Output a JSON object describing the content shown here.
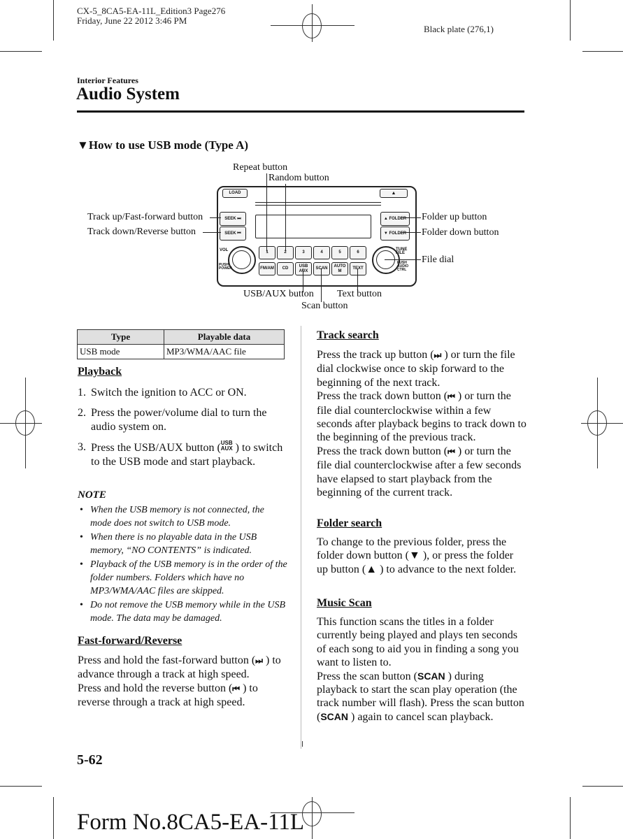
{
  "print_header": {
    "file_info": "CX-5_8CA5-EA-11L_Edition3 Page276",
    "date_info": "Friday, June 22 2012 3:46 PM",
    "plate": "Black plate (276,1)"
  },
  "section": {
    "label": "Interior Features",
    "title": "Audio System"
  },
  "subsection": {
    "marker": "▼",
    "title": "How to use USB mode (Type A)"
  },
  "diagram": {
    "callouts": {
      "repeat": "Repeat button",
      "random": "Random button",
      "track_up": "Track up/Fast-forward button",
      "track_down": "Track down/Reverse button",
      "folder_up": "Folder up button",
      "folder_down": "Folder down button",
      "file_dial": "File dial",
      "usb_aux": "USB/AUX button",
      "text": "Text button",
      "scan": "Scan button"
    },
    "device_labels": {
      "load": "LOAD",
      "eject": "▲",
      "seek_up": "SEEK ⏭",
      "seek_down": "SEEK ⏮",
      "folder_up": "▲ FOLDER",
      "folder_down": "▼ FOLDER",
      "presets": [
        "1",
        "2",
        "3",
        "4",
        "5",
        "6"
      ],
      "func_buttons": [
        "FM/AM",
        "CD",
        "USB AUX",
        "SCAN",
        "AUTO M",
        "TEXT"
      ],
      "vol": "VOL",
      "push_power": "PUSH POWER",
      "tune_file": "TUNE FILE",
      "push_audio_ctrl": "PUSH AUDIO CTRL"
    }
  },
  "table": {
    "headers": [
      "Type",
      "Playable data"
    ],
    "rows": [
      [
        "USB mode",
        "MP3/WMA/AAC file"
      ]
    ]
  },
  "left_column": {
    "playback": {
      "heading": "Playback",
      "steps": [
        {
          "num": "1.",
          "text": "Switch the ignition to ACC or ON."
        },
        {
          "num": "2.",
          "text": "Press the power/volume dial to turn the audio system on."
        },
        {
          "num": "3.",
          "text_before": "Press the USB/AUX button (",
          "icon_top": "USB",
          "icon_bottom": "AUX",
          "text_after": " ) to switch to the USB mode and start playback."
        }
      ]
    },
    "note": {
      "heading": "NOTE",
      "bullet": "•",
      "items": [
        "When the USB memory is not connected, the mode does not switch to USB mode.",
        "When there is no playable data in the USB memory, “NO CONTENTS” is indicated.",
        "Playback of the USB memory is in the order of the folder numbers. Folders which have no MP3/WMA/AAC files are skipped.",
        "Do not remove the USB memory while in the USB mode. The data may be damaged."
      ]
    },
    "fast_forward": {
      "heading": "Fast-forward/Reverse",
      "p1_before": "Press and hold the fast-forward button (",
      "p1_glyph": "⏭",
      "p1_after": " ) to advance through a track at high speed.",
      "p2_before": "Press and hold the reverse button (",
      "p2_glyph": "⏮",
      "p2_after": " ) to reverse through a track at high speed."
    }
  },
  "right_column": {
    "track_search": {
      "heading": "Track search",
      "p1_before": "Press the track up button (",
      "p1_glyph": "⏭",
      "p1_after": " ) or turn the file dial clockwise once to skip forward to the beginning of the next track.",
      "p2_before": "Press the track down button (",
      "p2_glyph": "⏮",
      "p2_after": " ) or turn the file dial counterclockwise within a few seconds after playback begins to track down to the beginning of the previous track.",
      "p3_before": "Press the track down button (",
      "p3_glyph": "⏮",
      "p3_after": " ) or turn the file dial counterclockwise after a few seconds have elapsed to start playback from the beginning of the current track."
    },
    "folder_search": {
      "heading": "Folder search",
      "t1": "To change to the previous folder, press the folder down button (",
      "g1": "▼",
      "t2": " ), or press the folder up button (",
      "g2": "▲",
      "t3": " ) to advance to the next folder."
    },
    "music_scan": {
      "heading": "Music Scan",
      "p1": "This function scans the titles in a folder currently being played and plays ten seconds of each song to aid you in finding a song you want to listen to.",
      "p2_a": "Press the scan button (",
      "scan_glyph": "SCAN",
      "p2_b": " ) during playback to start the scan play operation (the track number will flash). Press the scan button (",
      "p2_c": " ) again to cancel scan playback."
    }
  },
  "footer": {
    "page_number": "5-62",
    "form_number": "Form No.8CA5-EA-11L"
  }
}
